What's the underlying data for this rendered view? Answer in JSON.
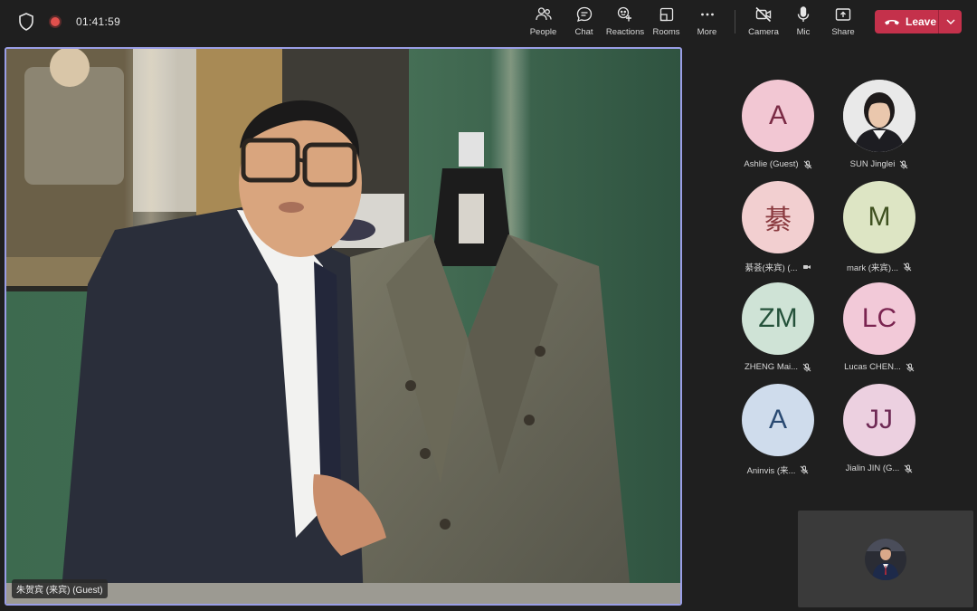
{
  "meeting": {
    "timer": "01:41:59"
  },
  "toolbar": {
    "people": "People",
    "chat": "Chat",
    "reactions": "Reactions",
    "rooms": "Rooms",
    "more": "More",
    "camera": "Camera",
    "mic": "Mic",
    "share": "Share",
    "leave": "Leave"
  },
  "main_video": {
    "name": "朱贺宾 (来宾) (Guest)"
  },
  "participants": [
    {
      "initials": "A",
      "name": "Ashlie (Guest)",
      "bg": "#f2c7d3",
      "fg": "#7a2a44",
      "status": "muted"
    },
    {
      "initials": "",
      "name": "SUN Jinglei",
      "bg": "#d9d9d9",
      "fg": "#333333",
      "status": "muted"
    },
    {
      "initials": "綦",
      "name": "綦荟(来宾) (...",
      "bg": "#f2cfd0",
      "fg": "#8a3a3f",
      "status": "video-off"
    },
    {
      "initials": "M",
      "name": "mark (来宾)...",
      "bg": "#dde5c4",
      "fg": "#3f5120",
      "status": "muted"
    },
    {
      "initials": "ZM",
      "name": "ZHENG Mai...",
      "bg": "#cfe3d6",
      "fg": "#24513a",
      "status": "muted"
    },
    {
      "initials": "LC",
      "name": "Lucas CHEN...",
      "bg": "#f2c9d8",
      "fg": "#7a2450",
      "status": "muted"
    },
    {
      "initials": "A",
      "name": "Aninvis (来...",
      "bg": "#cfdcec",
      "fg": "#2a4a72",
      "status": "muted"
    },
    {
      "initials": "JJ",
      "name": "Jialin JIN (G...",
      "bg": "#ecd0e0",
      "fg": "#6e2a55",
      "status": "muted"
    }
  ],
  "colors": {
    "leave": "#c4314b",
    "speaker_border": "#9a9ee6",
    "record": "#e0504d"
  }
}
